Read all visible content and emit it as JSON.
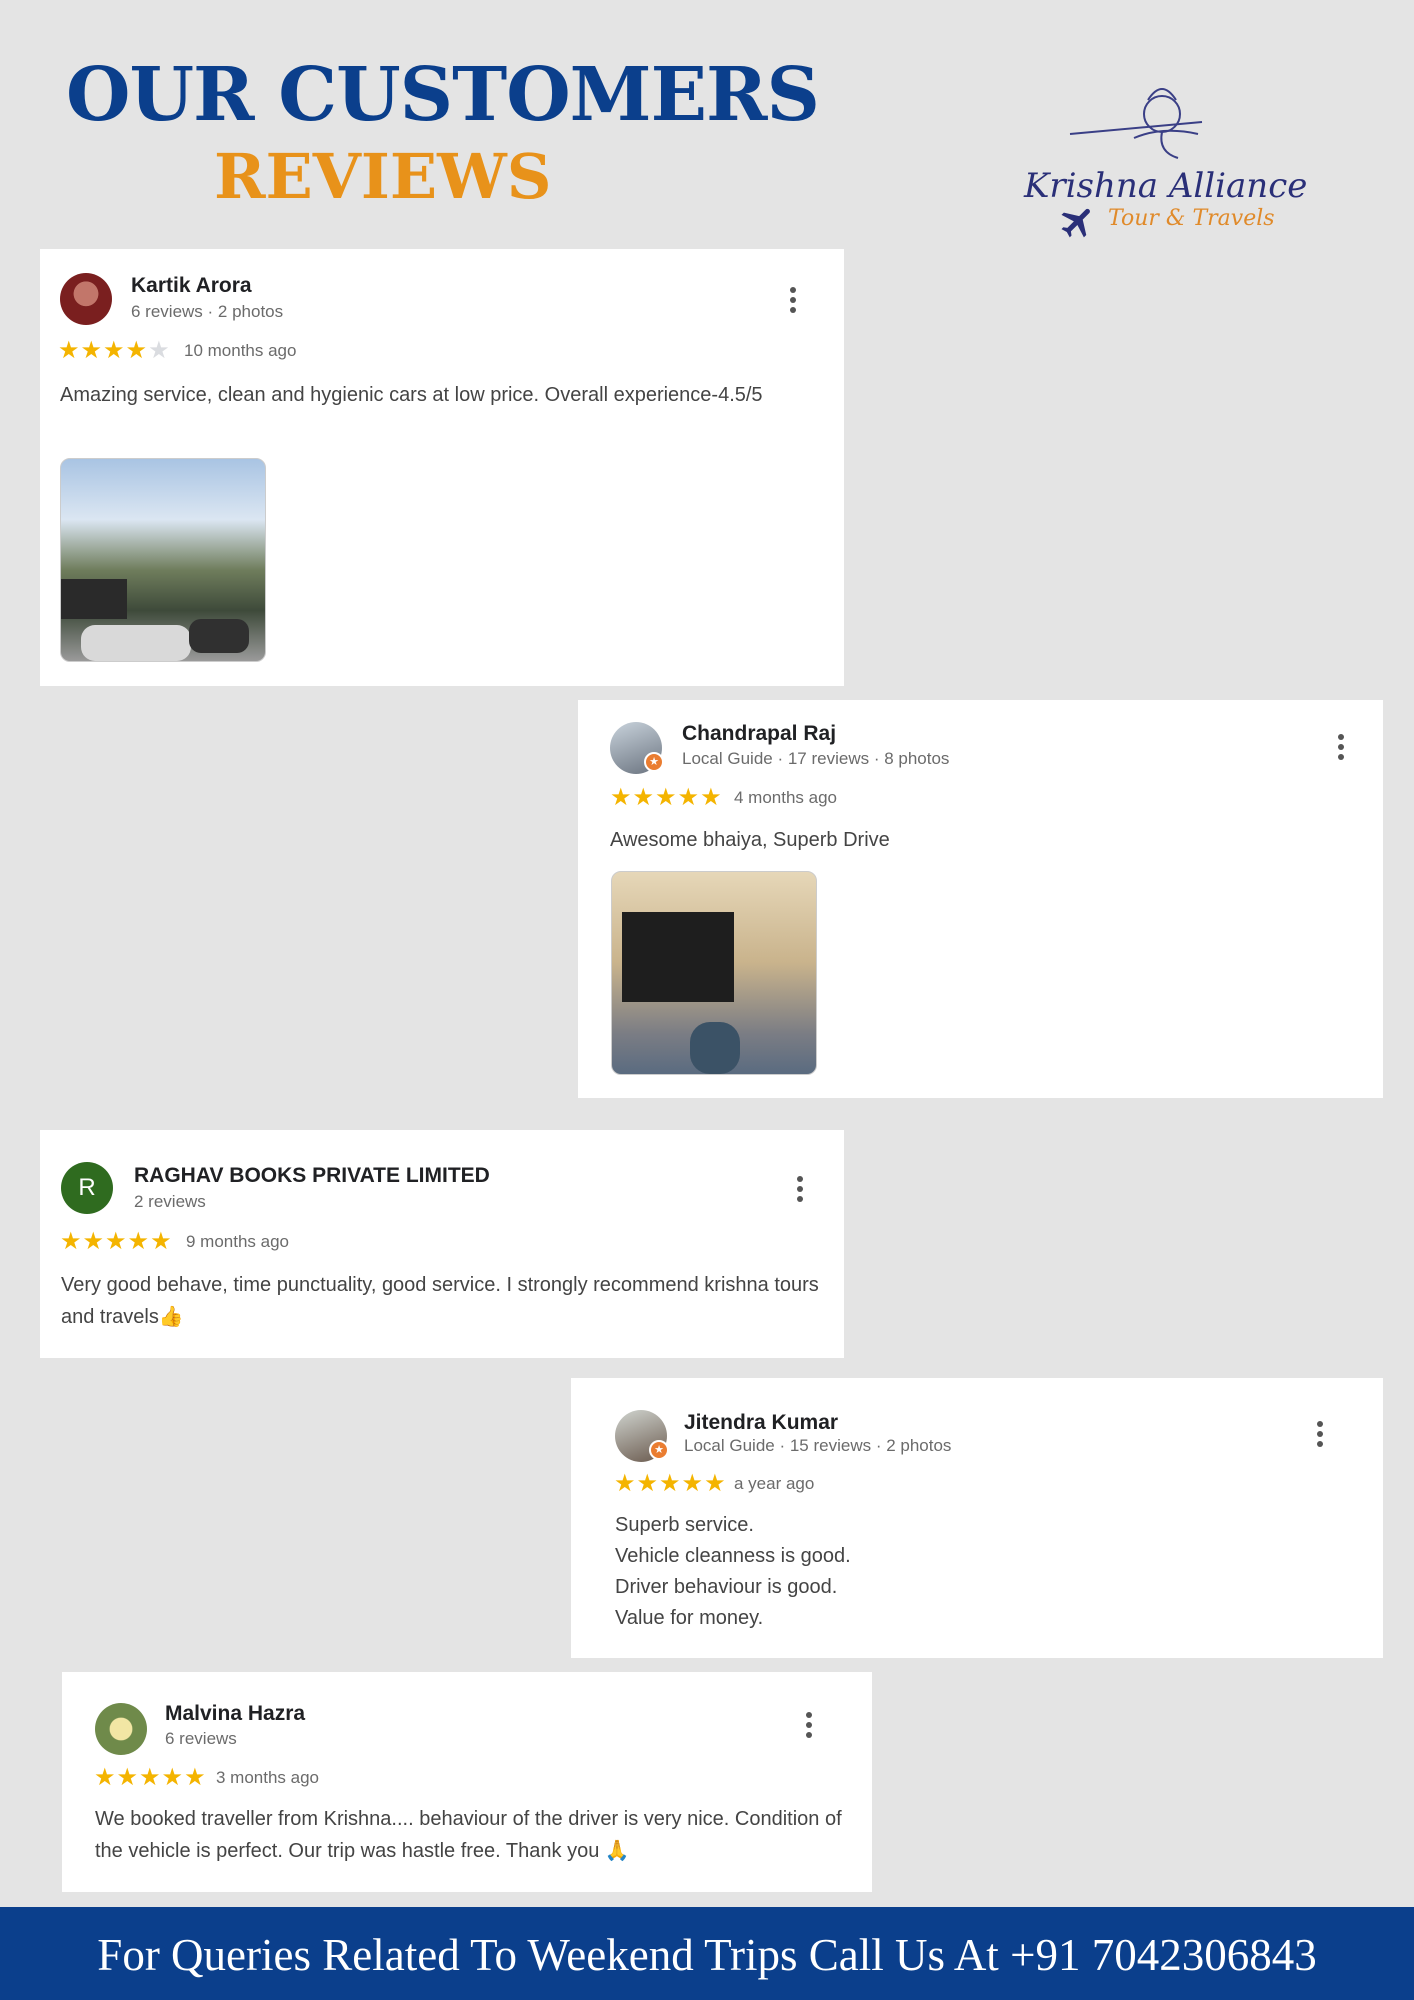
{
  "header": {
    "title_line1": "OUR CUSTOMERS",
    "title_line2": "REVIEWS"
  },
  "logo": {
    "brand": "Krishna Alliance",
    "tagline": "Tour & Travels"
  },
  "reviews": [
    {
      "name": "Kartik Arora",
      "meta": "6 reviews · 2 photos",
      "rating": 4,
      "ago": "10 months ago",
      "text": "Amazing service, clean and hygienic cars at low price. Overall experience-4.5/5"
    },
    {
      "name": "Chandrapal Raj",
      "meta": "Local Guide · 17 reviews · 8 photos",
      "rating": 5,
      "ago": "4 months ago",
      "text": "Awesome bhaiya, Superb Drive"
    },
    {
      "name": "RAGHAV BOOKS PRIVATE LIMITED",
      "meta": "2 reviews",
      "avatar_letter": "R",
      "rating": 5,
      "ago": "9 months ago",
      "text": "Very good behave, time punctuality, good service. I strongly recommend krishna tours and travels👍"
    },
    {
      "name": "Jitendra Kumar",
      "meta": "Local Guide · 15 reviews · 2 photos",
      "rating": 5,
      "ago": "a year ago",
      "text_lines": [
        "Superb service.",
        "Vehicle cleanness is good.",
        "Driver behaviour is good.",
        "Value for money."
      ]
    },
    {
      "name": "Malvina Hazra",
      "meta": "6 reviews",
      "rating": 5,
      "ago": "3 months ago",
      "text": "We booked traveller from Krishna.... behaviour of the driver is very nice. Condition of the vehicle is perfect. Our trip was hastle free. Thank you 🙏"
    }
  ],
  "stars_full": "★★★★★",
  "stars_four": "★★★★",
  "stars_off": "★",
  "footer": {
    "text": "For Queries Related To Weekend Trips Call Us At +91 7042306843"
  },
  "colors": {
    "brand_blue": "#0b3f8c",
    "brand_orange": "#e8921a",
    "star": "#f4b400",
    "background": "#e4e4e4"
  }
}
